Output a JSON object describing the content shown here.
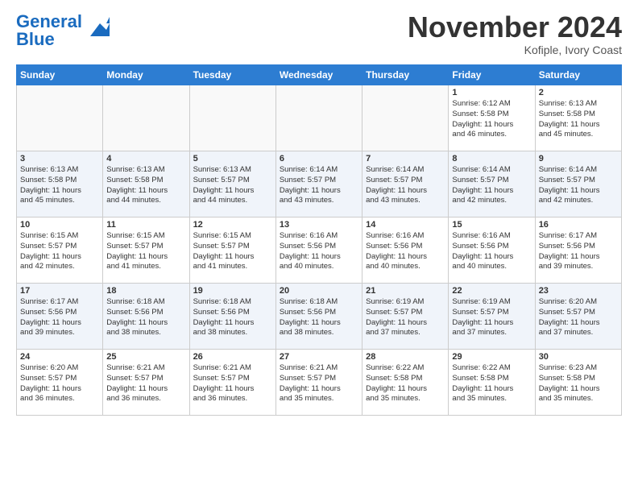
{
  "header": {
    "logo_line1": "General",
    "logo_line2": "Blue",
    "month": "November 2024",
    "location": "Kofiple, Ivory Coast"
  },
  "weekdays": [
    "Sunday",
    "Monday",
    "Tuesday",
    "Wednesday",
    "Thursday",
    "Friday",
    "Saturday"
  ],
  "weeks": [
    [
      {
        "day": "",
        "info": ""
      },
      {
        "day": "",
        "info": ""
      },
      {
        "day": "",
        "info": ""
      },
      {
        "day": "",
        "info": ""
      },
      {
        "day": "",
        "info": ""
      },
      {
        "day": "1",
        "info": "Sunrise: 6:12 AM\nSunset: 5:58 PM\nDaylight: 11 hours\nand 46 minutes."
      },
      {
        "day": "2",
        "info": "Sunrise: 6:13 AM\nSunset: 5:58 PM\nDaylight: 11 hours\nand 45 minutes."
      }
    ],
    [
      {
        "day": "3",
        "info": "Sunrise: 6:13 AM\nSunset: 5:58 PM\nDaylight: 11 hours\nand 45 minutes."
      },
      {
        "day": "4",
        "info": "Sunrise: 6:13 AM\nSunset: 5:58 PM\nDaylight: 11 hours\nand 44 minutes."
      },
      {
        "day": "5",
        "info": "Sunrise: 6:13 AM\nSunset: 5:57 PM\nDaylight: 11 hours\nand 44 minutes."
      },
      {
        "day": "6",
        "info": "Sunrise: 6:14 AM\nSunset: 5:57 PM\nDaylight: 11 hours\nand 43 minutes."
      },
      {
        "day": "7",
        "info": "Sunrise: 6:14 AM\nSunset: 5:57 PM\nDaylight: 11 hours\nand 43 minutes."
      },
      {
        "day": "8",
        "info": "Sunrise: 6:14 AM\nSunset: 5:57 PM\nDaylight: 11 hours\nand 42 minutes."
      },
      {
        "day": "9",
        "info": "Sunrise: 6:14 AM\nSunset: 5:57 PM\nDaylight: 11 hours\nand 42 minutes."
      }
    ],
    [
      {
        "day": "10",
        "info": "Sunrise: 6:15 AM\nSunset: 5:57 PM\nDaylight: 11 hours\nand 42 minutes."
      },
      {
        "day": "11",
        "info": "Sunrise: 6:15 AM\nSunset: 5:57 PM\nDaylight: 11 hours\nand 41 minutes."
      },
      {
        "day": "12",
        "info": "Sunrise: 6:15 AM\nSunset: 5:57 PM\nDaylight: 11 hours\nand 41 minutes."
      },
      {
        "day": "13",
        "info": "Sunrise: 6:16 AM\nSunset: 5:56 PM\nDaylight: 11 hours\nand 40 minutes."
      },
      {
        "day": "14",
        "info": "Sunrise: 6:16 AM\nSunset: 5:56 PM\nDaylight: 11 hours\nand 40 minutes."
      },
      {
        "day": "15",
        "info": "Sunrise: 6:16 AM\nSunset: 5:56 PM\nDaylight: 11 hours\nand 40 minutes."
      },
      {
        "day": "16",
        "info": "Sunrise: 6:17 AM\nSunset: 5:56 PM\nDaylight: 11 hours\nand 39 minutes."
      }
    ],
    [
      {
        "day": "17",
        "info": "Sunrise: 6:17 AM\nSunset: 5:56 PM\nDaylight: 11 hours\nand 39 minutes."
      },
      {
        "day": "18",
        "info": "Sunrise: 6:18 AM\nSunset: 5:56 PM\nDaylight: 11 hours\nand 38 minutes."
      },
      {
        "day": "19",
        "info": "Sunrise: 6:18 AM\nSunset: 5:56 PM\nDaylight: 11 hours\nand 38 minutes."
      },
      {
        "day": "20",
        "info": "Sunrise: 6:18 AM\nSunset: 5:56 PM\nDaylight: 11 hours\nand 38 minutes."
      },
      {
        "day": "21",
        "info": "Sunrise: 6:19 AM\nSunset: 5:57 PM\nDaylight: 11 hours\nand 37 minutes."
      },
      {
        "day": "22",
        "info": "Sunrise: 6:19 AM\nSunset: 5:57 PM\nDaylight: 11 hours\nand 37 minutes."
      },
      {
        "day": "23",
        "info": "Sunrise: 6:20 AM\nSunset: 5:57 PM\nDaylight: 11 hours\nand 37 minutes."
      }
    ],
    [
      {
        "day": "24",
        "info": "Sunrise: 6:20 AM\nSunset: 5:57 PM\nDaylight: 11 hours\nand 36 minutes."
      },
      {
        "day": "25",
        "info": "Sunrise: 6:21 AM\nSunset: 5:57 PM\nDaylight: 11 hours\nand 36 minutes."
      },
      {
        "day": "26",
        "info": "Sunrise: 6:21 AM\nSunset: 5:57 PM\nDaylight: 11 hours\nand 36 minutes."
      },
      {
        "day": "27",
        "info": "Sunrise: 6:21 AM\nSunset: 5:57 PM\nDaylight: 11 hours\nand 35 minutes."
      },
      {
        "day": "28",
        "info": "Sunrise: 6:22 AM\nSunset: 5:58 PM\nDaylight: 11 hours\nand 35 minutes."
      },
      {
        "day": "29",
        "info": "Sunrise: 6:22 AM\nSunset: 5:58 PM\nDaylight: 11 hours\nand 35 minutes."
      },
      {
        "day": "30",
        "info": "Sunrise: 6:23 AM\nSunset: 5:58 PM\nDaylight: 11 hours\nand 35 minutes."
      }
    ]
  ]
}
